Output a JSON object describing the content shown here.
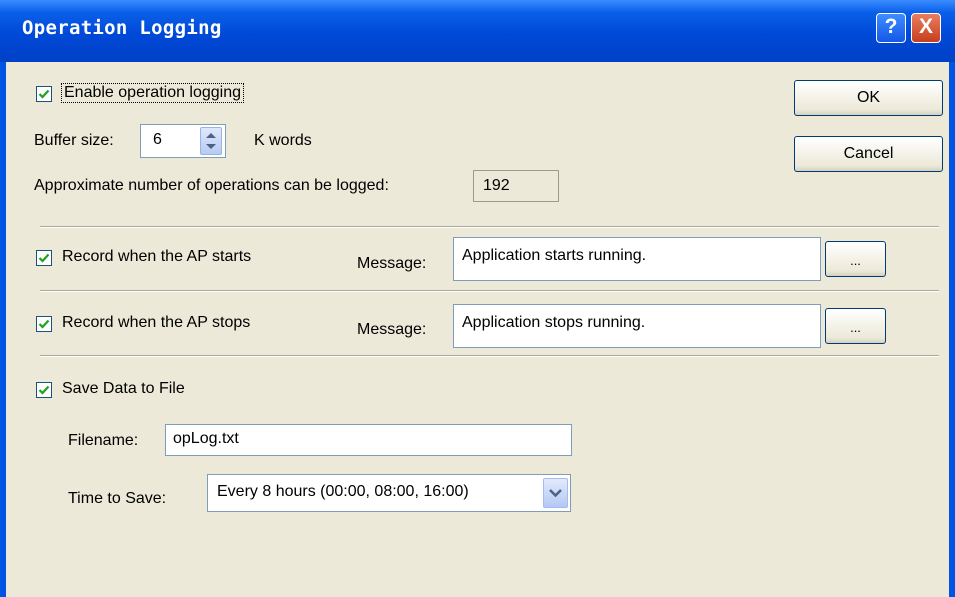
{
  "window": {
    "title": "Operation Logging",
    "help_glyph": "?",
    "close_glyph": "X"
  },
  "logging": {
    "enable_label": "Enable operation logging",
    "enable_checked": true,
    "buffer_label": "Buffer size:",
    "buffer_value": "6",
    "buffer_unit": "K words",
    "approx_label": "Approximate number of operations can be logged:",
    "approx_value": "192"
  },
  "buttons": {
    "ok": "OK",
    "cancel": "Cancel"
  },
  "start": {
    "label": "Record when the AP starts",
    "checked": true,
    "message_label": "Message:",
    "message_value": "Application starts running.",
    "browse_label": "..."
  },
  "stop": {
    "label": "Record when the AP stops",
    "checked": true,
    "message_label": "Message:",
    "message_value": "Application stops running.",
    "browse_label": "..."
  },
  "save": {
    "label": "Save Data to File",
    "checked": true,
    "filename_label": "Filename:",
    "filename_value": "opLog.txt",
    "time_label": "Time to Save:",
    "time_value": "Every 8 hours (00:00, 08:00, 16:00)"
  },
  "colors": {
    "titlebar": "#0054e3",
    "dialog_bg": "#ece9d8",
    "check": "#21a121"
  },
  "icons": {
    "check": "check-icon",
    "spin": "spin-arrows-icon",
    "dropdown": "chevron-down-icon"
  }
}
